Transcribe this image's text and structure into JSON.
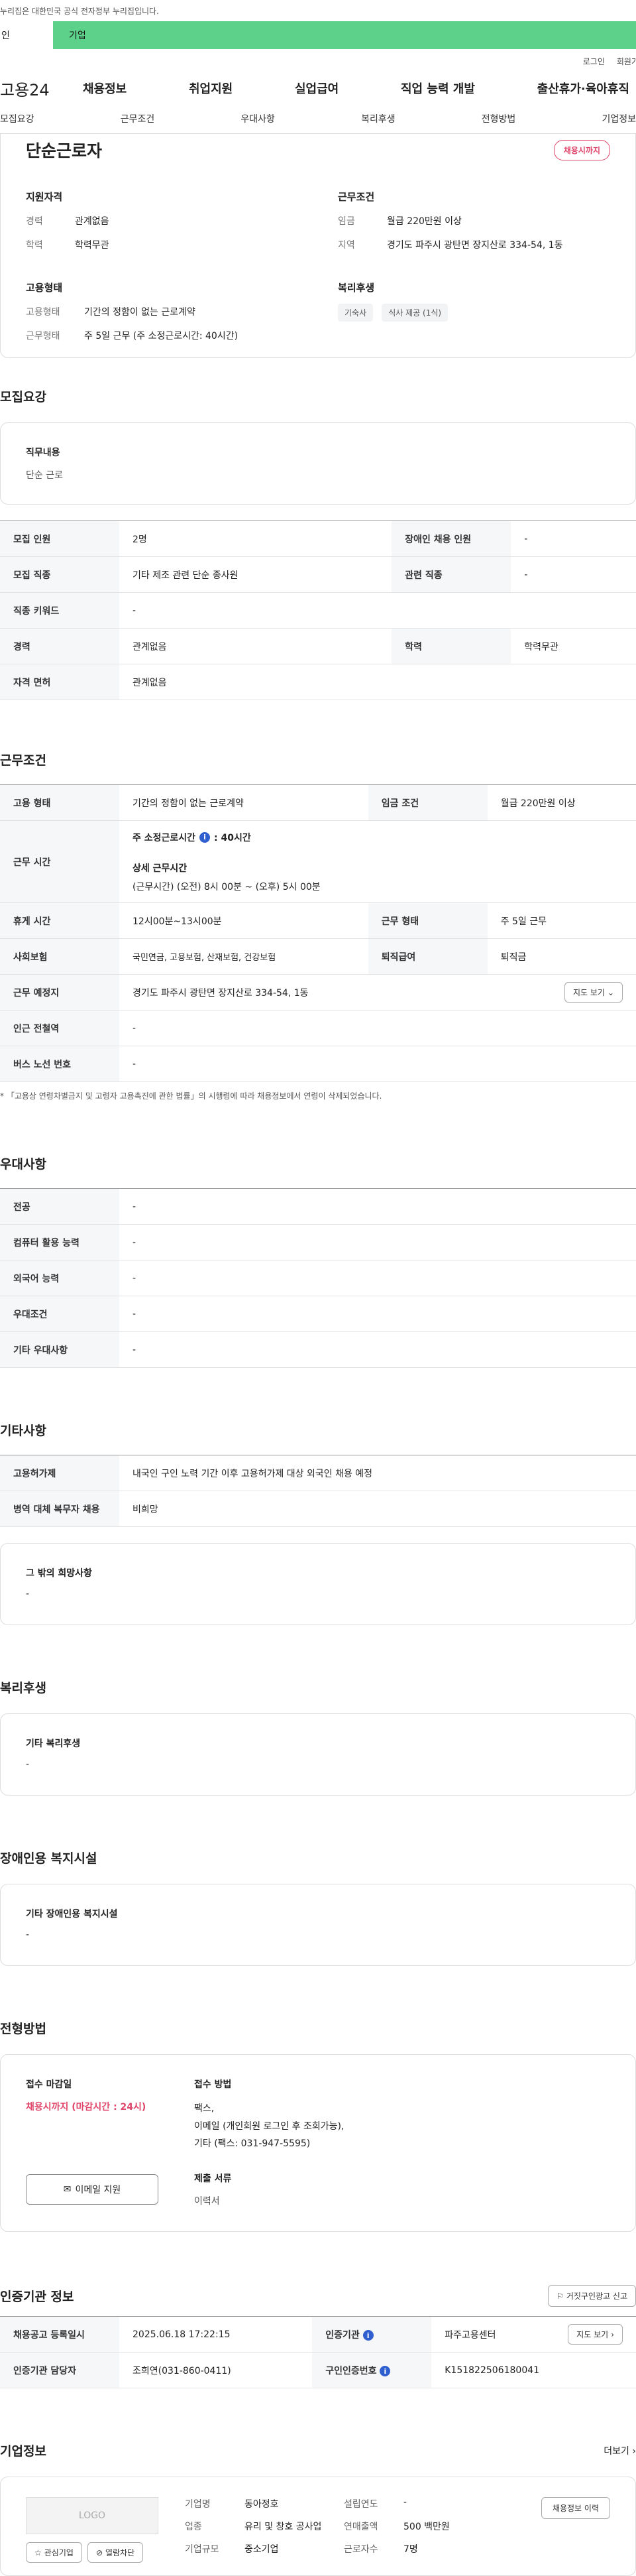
{
  "top_notice": "누리집은 대한민국 공식 전자정부 누리집입니다.",
  "user_tabs": [
    "인",
    "기업"
  ],
  "util": {
    "login": "로그인",
    "join": "회원가"
  },
  "logo": "고용24",
  "gnb": [
    "채용정보",
    "취업지원",
    "실업급여",
    "직업 능력 개발",
    "출산휴가·육아휴직"
  ],
  "subnav": [
    "모집요강",
    "근무조건",
    "우대사항",
    "복리후생",
    "전형방법",
    "기업정보"
  ],
  "header": {
    "title": "단순근로자",
    "badge": "채용시까지",
    "qual_title": "지원자격",
    "qual": [
      {
        "k": "경력",
        "v": "관계없음"
      },
      {
        "k": "학력",
        "v": "학력무관"
      }
    ],
    "cond_title": "근무조건",
    "cond": [
      {
        "k": "임금",
        "v": "월급 220만원 이상"
      },
      {
        "k": "지역",
        "v": "경기도 파주시 광탄면 장지산로 334-54, 1동"
      }
    ],
    "emp_title": "고용형태",
    "emp": [
      {
        "k": "고용형태",
        "v": "기간의 정함이 없는 근로계약"
      },
      {
        "k": "근무형태",
        "v": "주 5일 근무 (주 소정근로시간: 40시간)"
      }
    ],
    "welfare_title": "복리후생",
    "welfare_chips": [
      "기숙사",
      "식사 제공 (1식)"
    ]
  },
  "recruit": {
    "title": "모집요강",
    "duty_label": "직무내용",
    "duty_value": "단순 근로",
    "rows": [
      [
        "모집 인원",
        "2명",
        "장애인 채용 인원",
        "-"
      ],
      [
        "모집 직종",
        "기타 제조 관련 단순 종사원",
        "관련 직종",
        "-"
      ],
      [
        "직종 키워드",
        "-"
      ],
      [
        "경력",
        "관계없음",
        "학력",
        "학력무관"
      ],
      [
        "자격 면허",
        "관계없음"
      ]
    ]
  },
  "work": {
    "title": "근무조건",
    "emp_type_label": "고용 형태",
    "emp_type": "기간의 정함이 없는 근로계약",
    "wage_label": "임금 조건",
    "wage": "월급 220만원 이상",
    "hours_label": "근무 시간",
    "hours_weekly": "주 소정근로시간",
    "hours_weekly_val": ": 40시간",
    "hours_detail_title": "상세 근무시간",
    "hours_detail": "(근무시간) (오전) 8시 00분 ~ (오후) 5시 00분",
    "rest_label": "휴게 시간",
    "rest": "12시00분~13시00분",
    "form_label": "근무 형태",
    "form": "주 5일 근무",
    "ins_label": "사회보험",
    "ins": "국민연금, 고용보험, 산재보험, 건강보험",
    "sev_label": "퇴직급여",
    "sev": "퇴직금",
    "place_label": "근무 예정지",
    "place": "경기도 파주시 광탄면 장지산로 334-54, 1동",
    "map_btn": "지도 보기",
    "subway_label": "인근 전철역",
    "subway": "-",
    "bus_label": "버스 노선 번호",
    "bus": "-",
    "note": "* 「고용상 연령차별금지 및 고령자 고용촉진에 관한 법률」의 시행령에 따라 채용정보에서 연령이 삭제되었습니다."
  },
  "pref": {
    "title": "우대사항",
    "rows": [
      [
        "전공",
        "-"
      ],
      [
        "컴퓨터 활용 능력",
        "-"
      ],
      [
        "외국어 능력",
        "-"
      ],
      [
        "우대조건",
        "-"
      ],
      [
        "기타 우대사항",
        "-"
      ]
    ]
  },
  "etc": {
    "title": "기타사항",
    "rows": [
      [
        "고용허가제",
        "내국인 구인 노력 기간 이후 고용허가제 대상 외국인 채용 예정"
      ],
      [
        "병역 대체 복무자 채용",
        "비희망"
      ]
    ],
    "other_label": "그 밖의 희망사항",
    "other": "-"
  },
  "welfare": {
    "title": "복리후생",
    "label": "기타 복리후생",
    "value": "-"
  },
  "disabled": {
    "title": "장애인용 복지시설",
    "label": "기타 장애인용 복지시설",
    "value": "-"
  },
  "process": {
    "title": "전형방법",
    "deadline_label": "접수 마감일",
    "deadline": "채용시까지 (마감시간 : 24시)",
    "email_btn": "이메일 지원",
    "method_label": "접수 방법",
    "method_lines": [
      "팩스,",
      "이메일 (개인회원 로그인 후 조회가능),",
      "기타 (팩스: 031-947-5595)"
    ],
    "docs_label": "제출 서류",
    "docs": "이력서"
  },
  "agency": {
    "title": "인증기관 정보",
    "report_btn": "거짓구인광고 신고",
    "rows": [
      [
        "채용공고 등록일시",
        "2025.06.18 17:22:15",
        "인증기관",
        "파주고용센터"
      ],
      [
        "인증기관 담당자",
        "조희연(031-860-0411)",
        "구인인증번호",
        "K151822506180041"
      ]
    ],
    "map_btn": "지도 보기"
  },
  "company": {
    "title": "기업정보",
    "more": "더보기",
    "logo": "LOGO",
    "fav_btn": "관심기업",
    "block_btn": "열람차단",
    "name_label": "기업명",
    "name": "동아정호",
    "industry_label": "업종",
    "industry": "유리 및 창호 공사업",
    "size_label": "기업규모",
    "size": "중소기업",
    "est_label": "설립연도",
    "est": "-",
    "sales_label": "연매출액",
    "sales": "500 백만원",
    "emp_label": "근로자수",
    "emp": "7명",
    "history_btn": "채용정보 이력"
  }
}
